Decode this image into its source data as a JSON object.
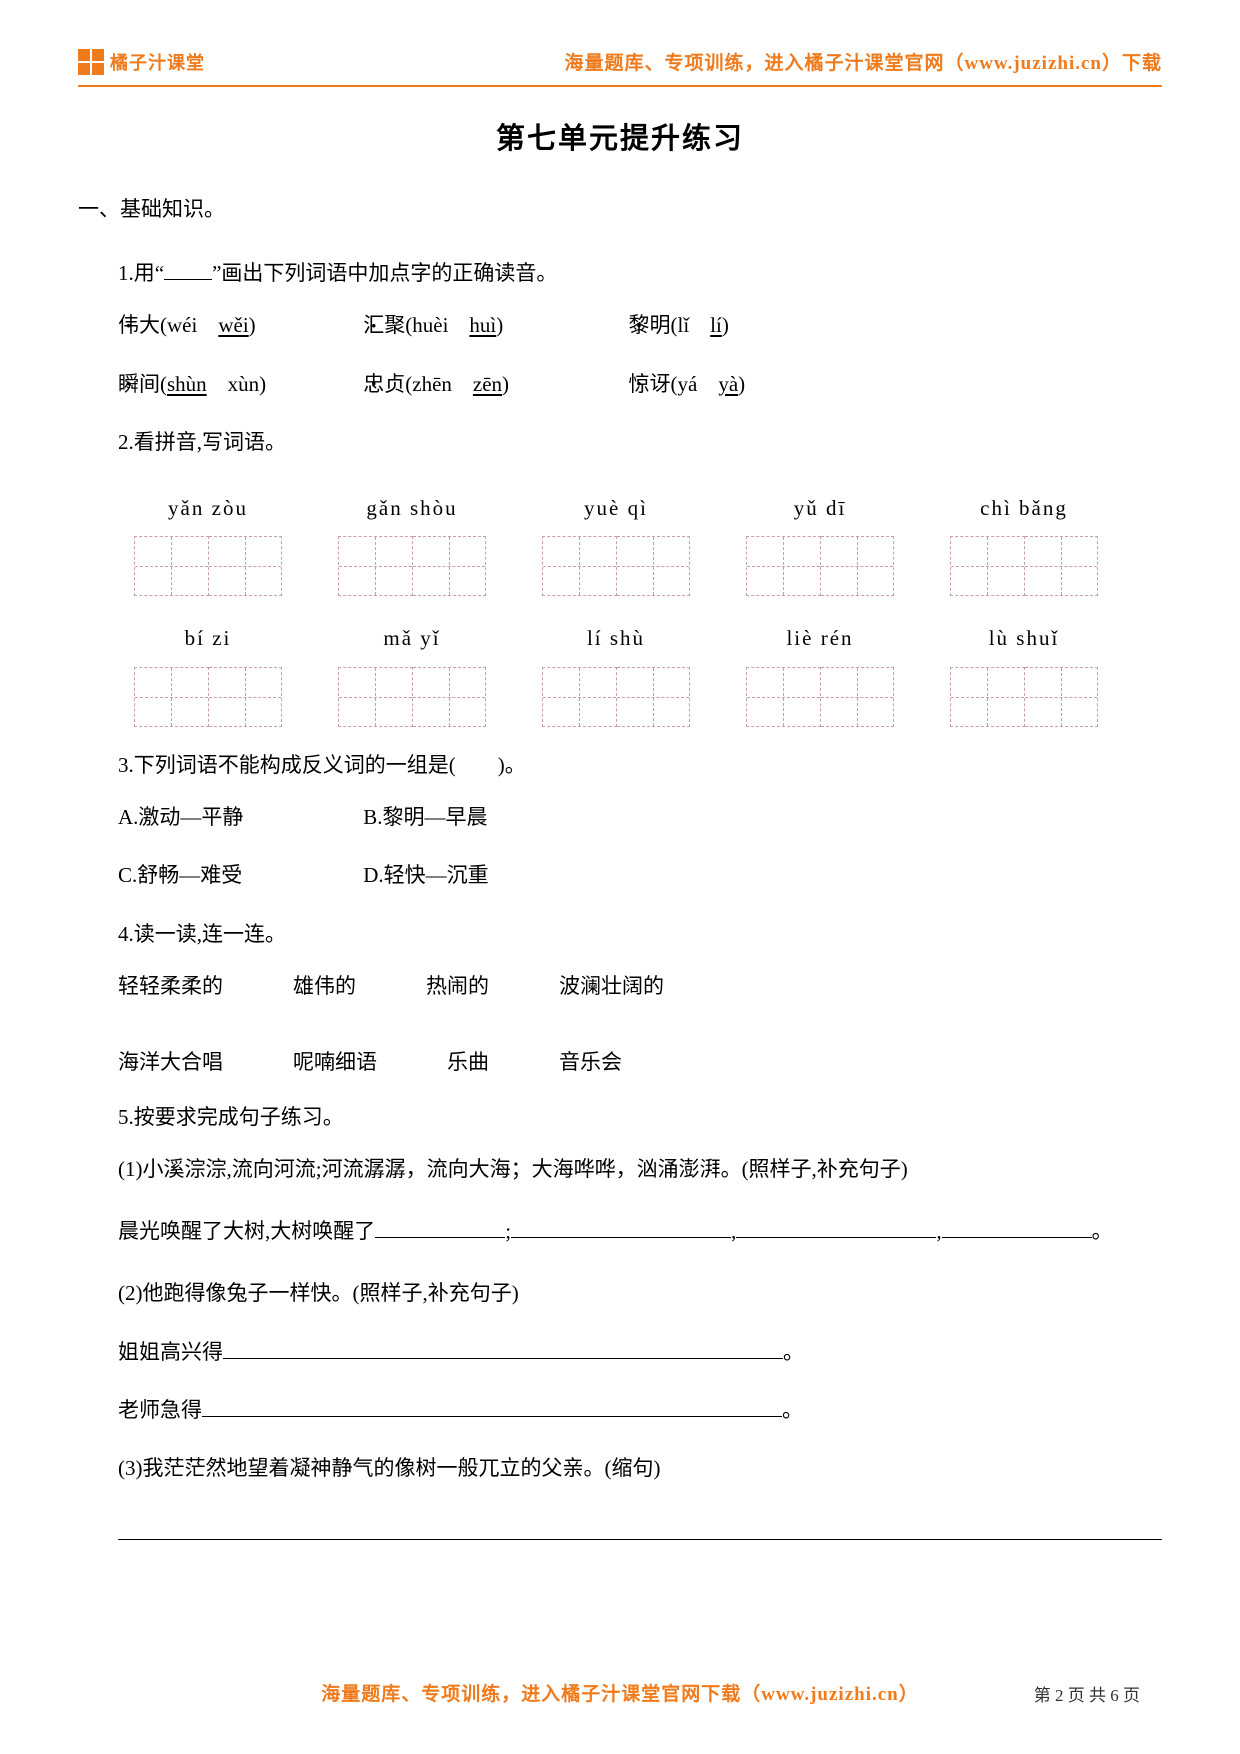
{
  "header": {
    "brand": "橘子汁课堂",
    "right": "海量题库、专项训练，进入橘子汁课堂官网（www.juzizhi.cn）下载"
  },
  "title": "第七单元提升练习",
  "section1": {
    "heading": "一、基础知识。",
    "q1": {
      "prompt_a": "1.用“",
      "prompt_b": "”画出下列词语中加点字的正确读音。",
      "r1c1_hz": "伟",
      "r1c1_rest": "大(wéi　",
      "r1c1_u": "wěi",
      "r1c1_end": ")",
      "r1c2_hz": "汇",
      "r1c2_rest": "聚(huèi　",
      "r1c2_u": "huì",
      "r1c2_end": ")",
      "r1c3_hz": "黎",
      "r1c3_rest": "明(lǐ　",
      "r1c3_u": "lí",
      "r1c3_end": ")",
      "r2c1_hz": "瞬",
      "r2c1_rest": "间(",
      "r2c1_u": "shùn",
      "r2c1_mid": "　xùn)",
      "r2c2_hz": "忠",
      "r2c2_rest": "贞(zhēn　",
      "r2c2_u": "zēn",
      "r2c2_end": ")",
      "r2c3_hz": "惊",
      "r2c3_rest": "讶(yá　",
      "r2c3_u": "yà",
      "r2c3_end": ")"
    },
    "q2": {
      "prompt": "2.看拼音,写词语。",
      "row1": [
        "yǎn zòu",
        "gǎn shòu",
        "yuè qì",
        "yǔ dī",
        "chì  bǎng"
      ],
      "row2": [
        "bí   zi",
        "mǎ   yǐ",
        "lí  shù",
        "liè  rén",
        "lù  shuǐ"
      ]
    },
    "q3": {
      "prompt": "3.下列词语不能构成反义词的一组是(　　)。",
      "optA": "A.激动—平静",
      "optB": "B.黎明—早晨",
      "optC": "C.舒畅—难受",
      "optD": "D.轻快—沉重"
    },
    "q4": {
      "prompt": "4.读一读,连一连。",
      "top": [
        "轻轻柔柔的",
        "雄伟的",
        "热闹的",
        "波澜壮阔的"
      ],
      "bottom": [
        "海洋大合唱",
        "呢喃细语",
        "乐曲",
        "音乐会"
      ]
    },
    "q5": {
      "prompt": "5.按要求完成句子练习。",
      "p1": "(1)小溪淙淙,流向河流;河流潺潺，流向大海；大海哗哗，汹涌澎湃。(照样子,补充句子)",
      "p1_lead": "晨光唤醒了大树,大树唤醒了",
      "p2": "(2)他跑得像兔子一样快。(照样子,补充句子)",
      "p2_a": "姐姐高兴得",
      "p2_b": "老师急得",
      "p3": "(3)我茫茫然地望着凝神静气的像树一般兀立的父亲。(缩句)"
    }
  },
  "footer": {
    "main": "海量题库、专项训练，进入橘子汁课堂官网下载（www.juzizhi.cn）",
    "page": "第 2 页 共 6 页"
  }
}
